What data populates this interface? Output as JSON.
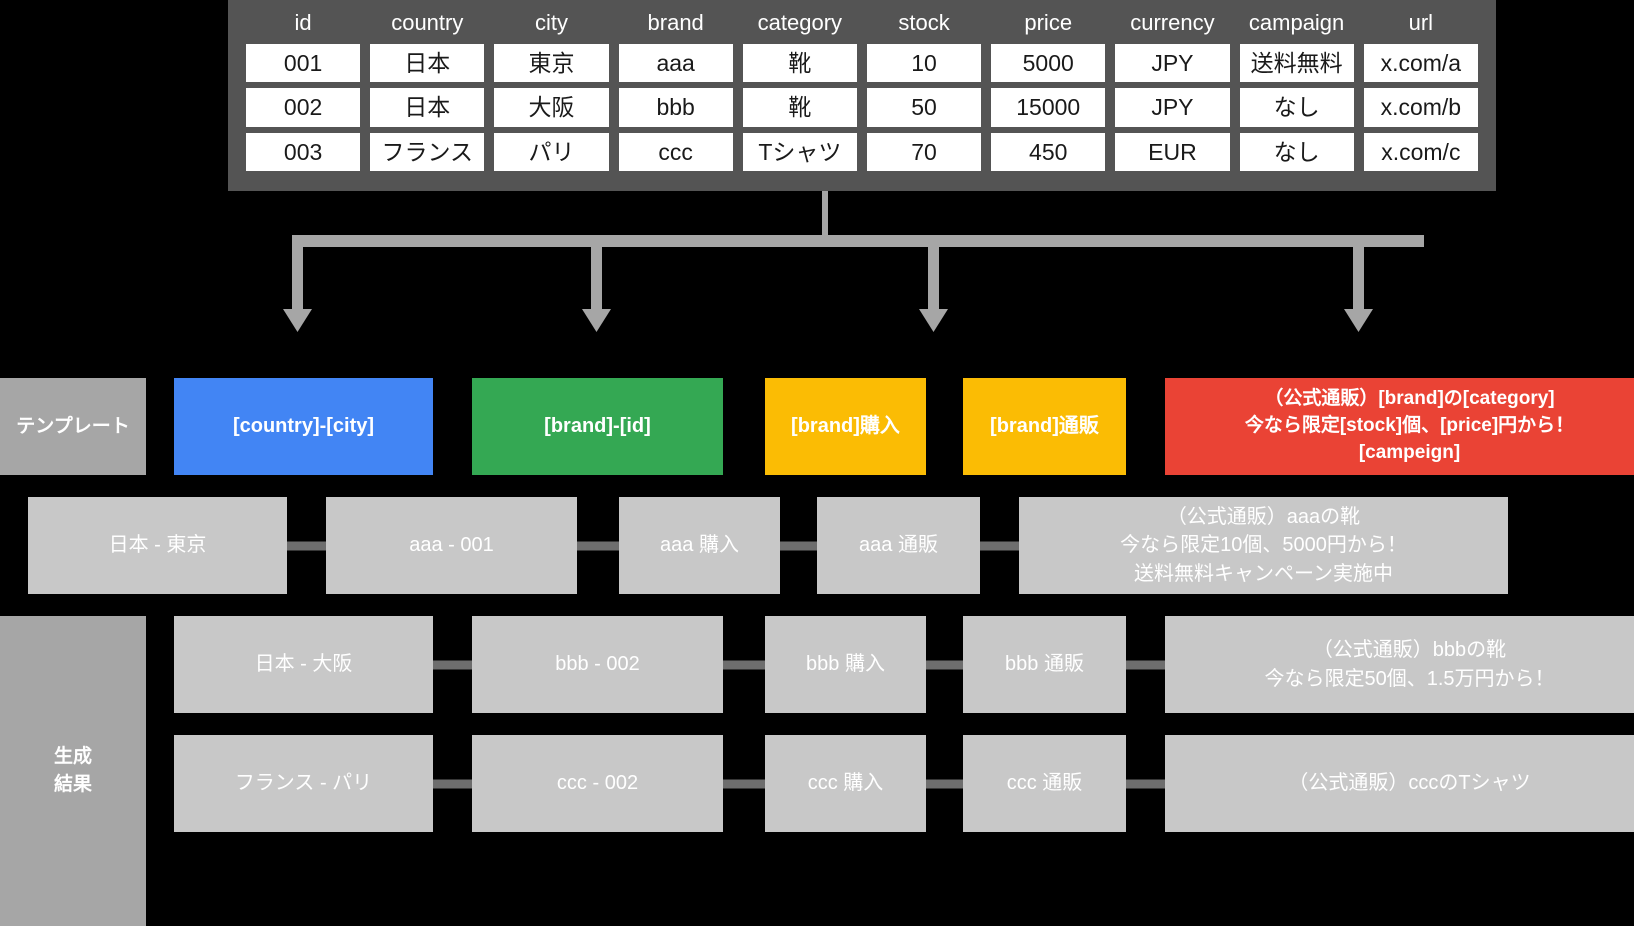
{
  "source_table": {
    "headers": [
      "id",
      "country",
      "city",
      "brand",
      "category",
      "stock",
      "price",
      "currency",
      "campaign",
      "url"
    ],
    "rows": [
      [
        "001",
        "日本",
        "東京",
        "aaa",
        "靴",
        "10",
        "5000",
        "JPY",
        "送料無料",
        "x.com/a"
      ],
      [
        "002",
        "日本",
        "大阪",
        "bbb",
        "靴",
        "50",
        "15000",
        "JPY",
        "なし",
        "x.com/b"
      ],
      [
        "003",
        "フランス",
        "パリ",
        "ccc",
        "Tシャツ",
        "70",
        "450",
        "EUR",
        "なし",
        "x.com/c"
      ]
    ]
  },
  "labels": {
    "template": "テンプレート",
    "generated": "生成\n結果"
  },
  "templates": [
    {
      "text": "[country]-[city]",
      "color": "#4285f4"
    },
    {
      "text": "[brand]-[id]",
      "color": "#34a853"
    },
    {
      "text": "[brand]購入",
      "color": "#fbbc04"
    },
    {
      "text": "[brand]通販",
      "color": "#fbbc04"
    },
    {
      "text": "（公式通販）[brand]の[category]\n今なら限定[stock]個、[price]円から！\n[campeign]",
      "color": "#ea4335"
    }
  ],
  "generated_rows": [
    [
      "日本 - 東京",
      "aaa - 001",
      "aaa 購入",
      "aaa 通販",
      "（公式通販）aaaの靴\n今なら限定10個、5000円から！\n送料無料キャンペーン実施中"
    ],
    [
      "日本 - 大阪",
      "bbb - 002",
      "bbb 購入",
      "bbb 通販",
      "（公式通販）bbbの靴\n今なら限定50個、1.5万円から！"
    ],
    [
      "フランス - パリ",
      "ccc - 002",
      "ccc 購入",
      "ccc 通販",
      "（公式通販）cccのTシャツ"
    ]
  ],
  "colors": {
    "background": "#000000",
    "table_panel": "#545454",
    "cell_fill": "#ffffff",
    "side_label": "#a6a6a6",
    "generated_cell": "#c8c8c8",
    "connector": "#a6a6a6",
    "nub": "#6e6e6e"
  }
}
